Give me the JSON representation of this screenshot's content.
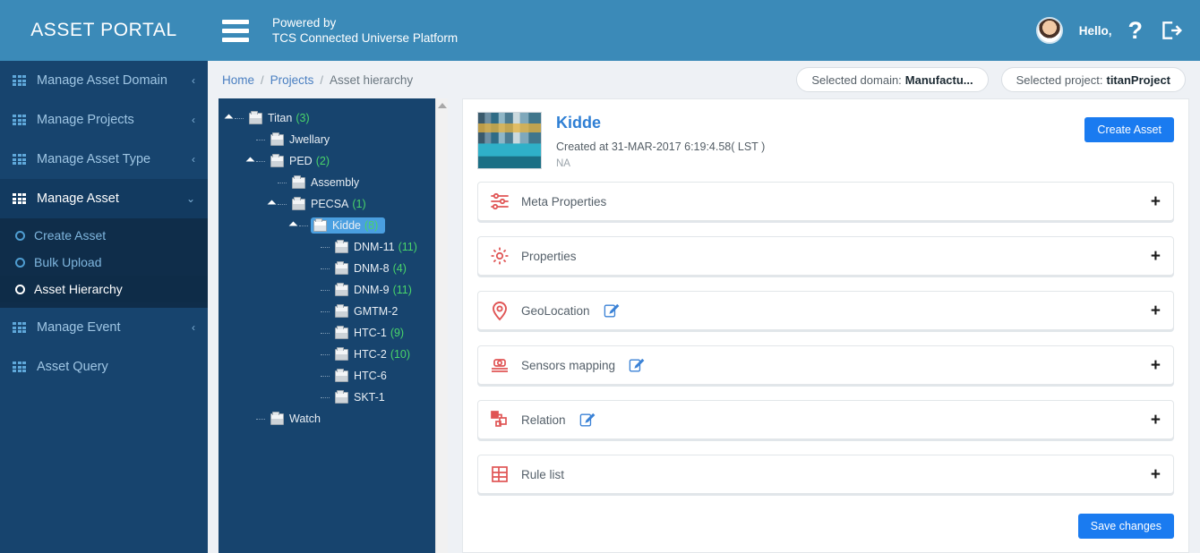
{
  "header": {
    "brand": "ASSET PORTAL",
    "menu_icon": "hamburger-icon",
    "powered_line1": "Powered by",
    "powered_line2": "TCS Connected Universe Platform",
    "greeting": "Hello,",
    "help_label": "?",
    "accent_color": "#3b8ab8"
  },
  "sidebar": {
    "bg_color": "#17446e",
    "items": [
      {
        "label": "Manage Asset Domain",
        "icon": "grid-icon",
        "chevron": "‹",
        "expanded": false
      },
      {
        "label": "Manage Projects",
        "icon": "grid-icon",
        "chevron": "‹",
        "expanded": false
      },
      {
        "label": "Manage Asset Type",
        "icon": "grid-icon",
        "chevron": "‹",
        "expanded": false
      },
      {
        "label": "Manage Asset",
        "icon": "grid-icon",
        "chevron": "⌄",
        "expanded": true
      },
      {
        "label": "Manage Event",
        "icon": "grid-icon",
        "chevron": "‹",
        "expanded": false
      },
      {
        "label": "Asset Query",
        "icon": "grid-icon",
        "chevron": "",
        "expanded": false
      }
    ],
    "submenu": [
      {
        "label": "Create Asset",
        "active": false
      },
      {
        "label": "Bulk Upload",
        "active": false
      },
      {
        "label": "Asset Hierarchy",
        "active": true
      }
    ]
  },
  "breadcrumb": {
    "items": [
      "Home",
      "Projects",
      "Asset hierarchy"
    ],
    "separator": "/"
  },
  "chips": {
    "domain_prefix": "Selected domain:",
    "domain_value": "Manufactu...",
    "project_prefix": "Selected project:",
    "project_value": "titanProject"
  },
  "tree": {
    "nodes": [
      {
        "label": "Titan",
        "count": "(3)",
        "depth": 0,
        "arrow": true,
        "selected": false
      },
      {
        "label": "Jwellary",
        "count": "",
        "depth": 1,
        "arrow": false,
        "selected": false
      },
      {
        "label": "PED",
        "count": "(2)",
        "depth": 1,
        "arrow": true,
        "selected": false
      },
      {
        "label": "Assembly",
        "count": "",
        "depth": 2,
        "arrow": false,
        "selected": false
      },
      {
        "label": "PECSA",
        "count": "(1)",
        "depth": 2,
        "arrow": true,
        "selected": false
      },
      {
        "label": "Kidde",
        "count": "(8)",
        "depth": 3,
        "arrow": true,
        "selected": true
      },
      {
        "label": "DNM-11",
        "count": "(11)",
        "depth": 4,
        "arrow": false,
        "selected": false
      },
      {
        "label": "DNM-8",
        "count": "(4)",
        "depth": 4,
        "arrow": false,
        "selected": false
      },
      {
        "label": "DNM-9",
        "count": "(11)",
        "depth": 4,
        "arrow": false,
        "selected": false
      },
      {
        "label": "GMTM-2",
        "count": "",
        "depth": 4,
        "arrow": false,
        "selected": false
      },
      {
        "label": "HTC-1",
        "count": "(9)",
        "depth": 4,
        "arrow": false,
        "selected": false
      },
      {
        "label": "HTC-2",
        "count": "(10)",
        "depth": 4,
        "arrow": false,
        "selected": false
      },
      {
        "label": "HTC-6",
        "count": "",
        "depth": 4,
        "arrow": false,
        "selected": false
      },
      {
        "label": "SKT-1",
        "count": "",
        "depth": 4,
        "arrow": false,
        "selected": false
      },
      {
        "label": "Watch",
        "count": "",
        "depth": 1,
        "arrow": false,
        "selected": false
      }
    ]
  },
  "asset": {
    "title": "Kidde",
    "created": "Created at 31-MAR-2017 6:19:4.58( LST )",
    "description": "NA",
    "create_button": "Create Asset",
    "save_button": "Save changes",
    "thumbnail_alt": "asset-photo"
  },
  "sections": [
    {
      "label": "Meta Properties",
      "icon": "sliders-icon",
      "editable": false,
      "expand": "+"
    },
    {
      "label": "Properties",
      "icon": "gear-icon",
      "editable": false,
      "expand": "+"
    },
    {
      "label": "GeoLocation",
      "icon": "map-pin-icon",
      "editable": true,
      "expand": "+"
    },
    {
      "label": "Sensors mapping",
      "icon": "sensor-icon",
      "editable": true,
      "expand": "+"
    },
    {
      "label": "Relation",
      "icon": "relation-icon",
      "editable": true,
      "expand": "+"
    },
    {
      "label": "Rule list",
      "icon": "table-icon",
      "editable": false,
      "expand": "+"
    }
  ]
}
